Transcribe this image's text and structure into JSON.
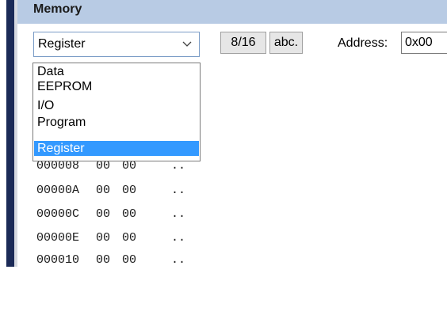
{
  "panel": {
    "title": "Memory"
  },
  "toolbar": {
    "memory_type": "Register",
    "width_button": "8/16",
    "ascii_button": "abc.",
    "address_label": "Address:",
    "address_value": "0x00"
  },
  "dropdown": {
    "options": [
      "Data",
      "EEPROM",
      "I/O",
      "Program",
      "Register"
    ],
    "selected": "Register"
  },
  "memory_rows": [
    {
      "address": "000008",
      "bytes": [
        "00",
        "00"
      ],
      "ascii": ".."
    },
    {
      "address": "00000A",
      "bytes": [
        "00",
        "00"
      ],
      "ascii": ".."
    },
    {
      "address": "00000C",
      "bytes": [
        "00",
        "00"
      ],
      "ascii": ".."
    },
    {
      "address": "00000E",
      "bytes": [
        "00",
        "00"
      ],
      "ascii": ".."
    },
    {
      "address": "000010",
      "bytes": [
        "00",
        "00"
      ],
      "ascii": ".."
    }
  ],
  "colors": {
    "title_bar": "#b8cbe4",
    "selection": "#3399ff",
    "left_frame": "#1b2a57"
  }
}
